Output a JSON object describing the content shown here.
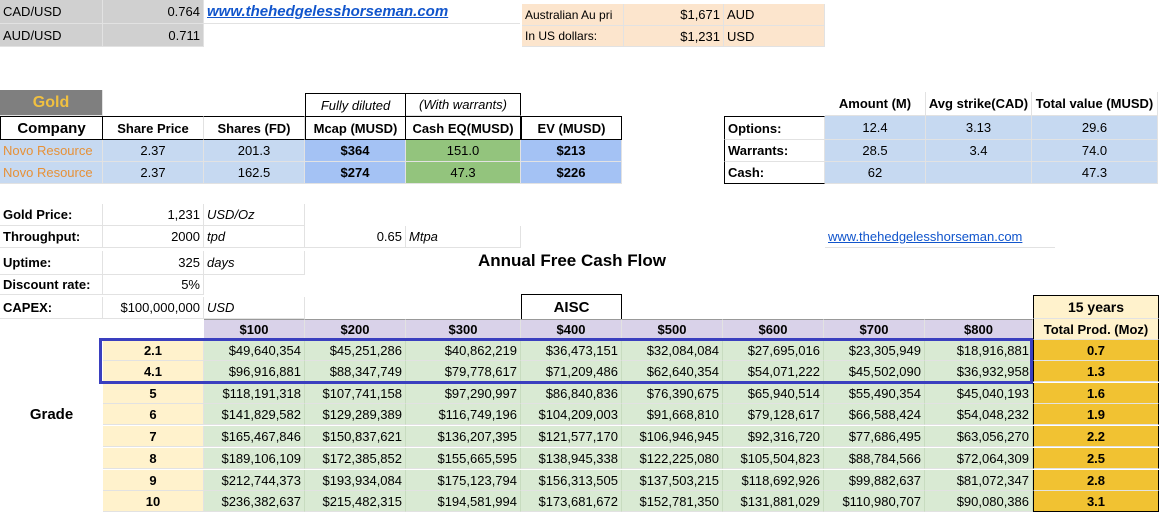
{
  "fx": {
    "cadusd_label": "CAD/USD",
    "cadusd_value": "0.764",
    "audusd_label": "AUD/USD",
    "audusd_value": "0.711",
    "link": "www.thehedgelesshorseman.com"
  },
  "au_price": {
    "label1": "Australian Au pri",
    "value1": "$1,671",
    "unit1": "AUD",
    "label2": "In US dollars:",
    "value2": "$1,231",
    "unit2": "USD"
  },
  "company_table": {
    "gold_label": "Gold",
    "company_label": "Company",
    "fully_diluted": "Fully diluted",
    "with_warrants": "(With warrants)",
    "headers": [
      "Share Price",
      "Shares (FD)",
      "Mcap (MUSD)",
      "Cash EQ(MUSD)",
      "EV (MUSD)"
    ],
    "rows": [
      {
        "name": "Novo Resource",
        "price": "2.37",
        "shares": "201.3",
        "mcap": "$364",
        "cash": "151.0",
        "ev": "$213"
      },
      {
        "name": "Novo Resource",
        "price": "2.37",
        "shares": "162.5",
        "mcap": "$274",
        "cash": "47.3",
        "ev": "$226"
      }
    ]
  },
  "options_table": {
    "headers": [
      "Amount (M)",
      "Avg strike(CAD)",
      "Total value (MUSD)"
    ],
    "rows": [
      {
        "label": "Options:",
        "amount": "12.4",
        "strike": "3.13",
        "total": "29.6"
      },
      {
        "label": "Warrants:",
        "amount": "28.5",
        "strike": "3.4",
        "total": "74.0"
      },
      {
        "label": "Cash:",
        "amount": "62",
        "strike": "",
        "total": "47.3"
      }
    ]
  },
  "params": {
    "gold_price_label": "Gold Price:",
    "gold_price": "1,231",
    "gold_price_unit": "USD/Oz",
    "throughput_label": "Throughput:",
    "throughput": "2000",
    "throughput_unit": "tpd",
    "mtpa_value": "0.65",
    "mtpa_unit": "Mtpa",
    "uptime_label": "Uptime:",
    "uptime": "325",
    "uptime_unit": "days",
    "discount_label": "Discount rate:",
    "discount": "5%",
    "capex_label": "CAPEX:",
    "capex": "$100,000,000",
    "capex_unit": "USD",
    "link2": "www.thehedgelesshorseman.com"
  },
  "fcf": {
    "title": "Annual Free Cash Flow",
    "aisc_label": "AISC",
    "years_label": "15 years",
    "total_prod_label": "Total Prod. (Moz)",
    "grade_label": "Grade",
    "aisc_headers": [
      "$100",
      "$200",
      "$300",
      "$400",
      "$500",
      "$600",
      "$700",
      "$800"
    ],
    "rows": [
      {
        "grade": "2.1",
        "values": [
          "$49,640,354",
          "$45,251,286",
          "$40,862,219",
          "$36,473,151",
          "$32,084,084",
          "$27,695,016",
          "$23,305,949",
          "$18,916,881"
        ],
        "prod": "0.7"
      },
      {
        "grade": "4.1",
        "values": [
          "$96,916,881",
          "$88,347,749",
          "$79,778,617",
          "$71,209,486",
          "$62,640,354",
          "$54,071,222",
          "$45,502,090",
          "$36,932,958"
        ],
        "prod": "1.3"
      },
      {
        "grade": "5",
        "values": [
          "$118,191,318",
          "$107,741,158",
          "$97,290,997",
          "$86,840,836",
          "$76,390,675",
          "$65,940,514",
          "$55,490,354",
          "$45,040,193"
        ],
        "prod": "1.6"
      },
      {
        "grade": "6",
        "values": [
          "$141,829,582",
          "$129,289,389",
          "$116,749,196",
          "$104,209,003",
          "$91,668,810",
          "$79,128,617",
          "$66,588,424",
          "$54,048,232"
        ],
        "prod": "1.9"
      },
      {
        "grade": "7",
        "values": [
          "$165,467,846",
          "$150,837,621",
          "$136,207,395",
          "$121,577,170",
          "$106,946,945",
          "$92,316,720",
          "$77,686,495",
          "$63,056,270"
        ],
        "prod": "2.2"
      },
      {
        "grade": "8",
        "values": [
          "$189,106,109",
          "$172,385,852",
          "$155,665,595",
          "$138,945,338",
          "$122,225,080",
          "$105,504,823",
          "$88,784,566",
          "$72,064,309"
        ],
        "prod": "2.5"
      },
      {
        "grade": "9",
        "values": [
          "$212,744,373",
          "$193,934,084",
          "$175,123,794",
          "$156,313,505",
          "$137,503,215",
          "$118,692,926",
          "$99,882,637",
          "$81,072,347"
        ],
        "prod": "2.8"
      },
      {
        "grade": "10",
        "values": [
          "$236,382,637",
          "$215,482,315",
          "$194,581,994",
          "$173,681,672",
          "$152,781,350",
          "$131,881,029",
          "$110,980,707",
          "$90,080,386"
        ],
        "prod": "3.1"
      }
    ]
  }
}
